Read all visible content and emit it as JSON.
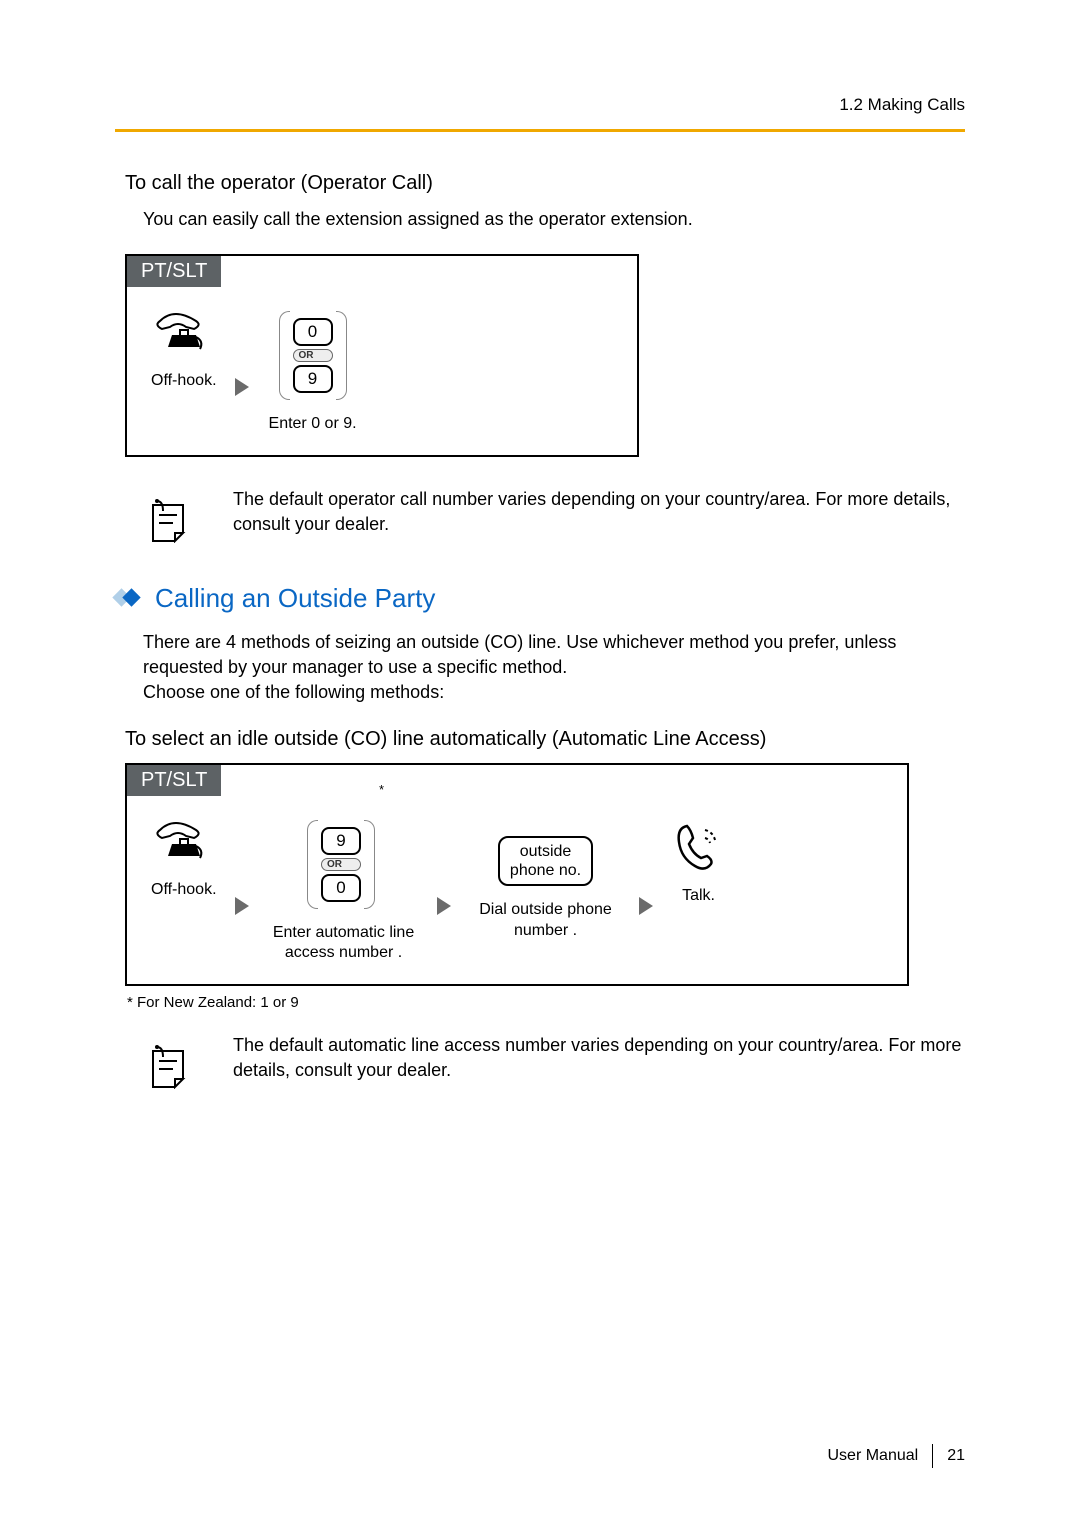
{
  "crumb": "1.2 Making Calls",
  "operator": {
    "heading": "To call the operator (Operator Call)",
    "intro": "You can easily call the extension assigned as the operator extension.",
    "box_label": "PT/SLT",
    "step1": "Off-hook.",
    "key0": "0",
    "or": "OR",
    "key9": "9",
    "step2": "Enter 0 or 9.",
    "note": "The default operator call number varies depending on your country/area. For more details, consult your dealer."
  },
  "outside": {
    "title": "Calling an Outside Party",
    "intro": "There are 4 methods of seizing an outside (CO) line. Use whichever method you prefer, unless requested by your manager to use a specific method.\nChoose one of the following methods:",
    "subheading": "To select an idle outside (CO) line automatically (Automatic Line Access)",
    "box_label": "PT/SLT",
    "step1": "Off-hook.",
    "key9": "9",
    "or": "OR",
    "key0": "0",
    "star": "*",
    "step2": "Enter automatic line access number .",
    "phone_key_l1": "outside",
    "phone_key_l2": "phone no.",
    "step3": "Dial outside phone number .",
    "step4": "Talk.",
    "footnote": "* For New Zealand: 1 or 9",
    "note": "The default automatic line access number varies depending on your country/area. For more details, consult your dealer."
  },
  "footer": {
    "manual": "User Manual",
    "page": "21"
  }
}
